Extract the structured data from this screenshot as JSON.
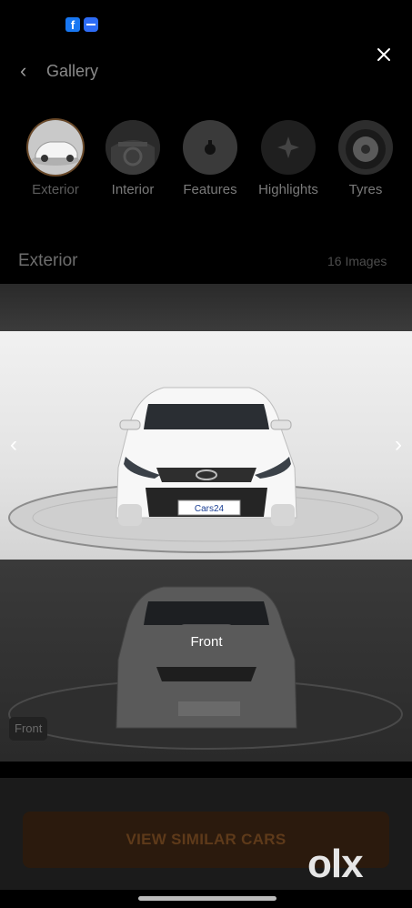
{
  "header": {
    "title": "Gallery"
  },
  "categories": [
    {
      "label": "Exterior",
      "active": true
    },
    {
      "label": "Interior",
      "active": false
    },
    {
      "label": "Features",
      "active": false
    },
    {
      "label": "Highlights",
      "active": false
    },
    {
      "label": "Tyres",
      "active": false
    }
  ],
  "section": {
    "title": "Exterior",
    "count": "16 Images"
  },
  "photo": {
    "caption": "Front",
    "plate": "Cars24"
  },
  "tag": {
    "label": "Front"
  },
  "cta": {
    "label": "VIEW SIMILAR CARS"
  },
  "watermark": "olx",
  "colors": {
    "accent": "#2b1a0d",
    "facebook": "#1877f2"
  }
}
